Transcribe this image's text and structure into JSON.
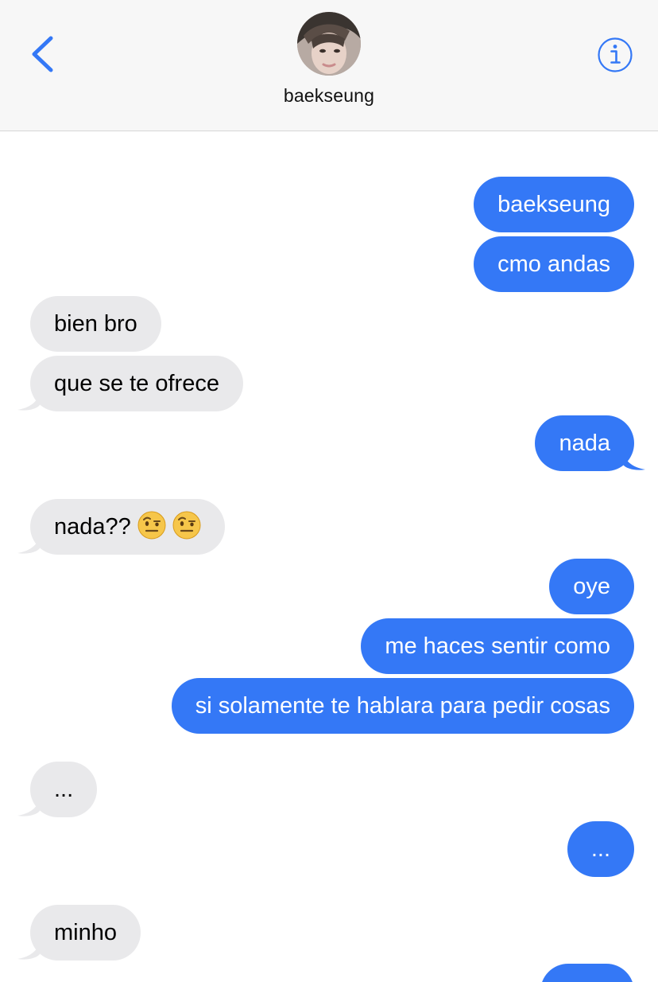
{
  "header": {
    "contact_name": "baekseung"
  },
  "colors": {
    "outgoing_bubble": "#3478f6",
    "incoming_bubble": "#e9e9eb",
    "accent": "#3478f6",
    "header_bg": "#f7f7f7"
  },
  "icons": {
    "back": "chevron-left-icon",
    "info": "info-circle-icon",
    "emoji": "face-with-raised-eyebrow-emoji"
  },
  "messages": [
    {
      "from": "me",
      "text": "baekseung"
    },
    {
      "from": "me",
      "text": "cmo andas"
    },
    {
      "from": "them",
      "text": "bien bro"
    },
    {
      "from": "them",
      "text": "que se te ofrece"
    },
    {
      "from": "me",
      "text": "nada"
    },
    {
      "from": "them",
      "text": "nada??",
      "emoji_count": 2
    },
    {
      "from": "me",
      "text": "oye"
    },
    {
      "from": "me",
      "text": "me haces sentir como"
    },
    {
      "from": "me",
      "text": "si solamente te hablara para pedir cosas"
    },
    {
      "from": "them",
      "text": "..."
    },
    {
      "from": "me",
      "text": "..."
    },
    {
      "from": "them",
      "text": "minho"
    },
    {
      "from": "me",
      "text": ""
    }
  ]
}
